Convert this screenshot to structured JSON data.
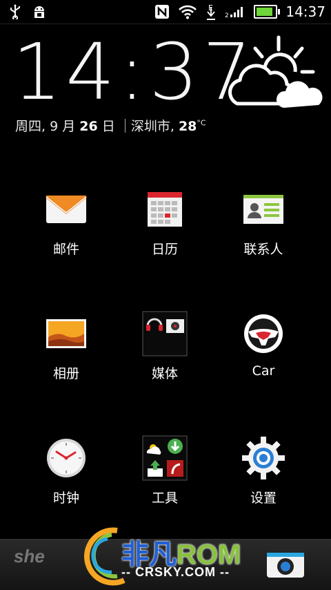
{
  "status_bar": {
    "time": "14:37",
    "icons": [
      "usb-icon",
      "android-debug-icon",
      "nfc-icon",
      "wifi-icon",
      "data-e-icon",
      "signal-icon",
      "battery-icon"
    ],
    "battery_level": 0.9,
    "battery_color": "#6fd63a"
  },
  "clock_widget": {
    "time": "14:37",
    "weekday": "周四,",
    "month": "9",
    "month_unit": "月",
    "day": "26",
    "day_unit": "日",
    "city": "深圳市,",
    "temperature": "28",
    "temp_unit": "°C",
    "weather_icon": "partly-cloudy-icon"
  },
  "apps": [
    {
      "label": "邮件",
      "icon": "mail-icon"
    },
    {
      "label": "日历",
      "icon": "calendar-icon"
    },
    {
      "label": "联系人",
      "icon": "contacts-icon"
    },
    {
      "label": "相册",
      "icon": "gallery-icon"
    },
    {
      "label": "媒体",
      "icon": "media-folder-icon"
    },
    {
      "label": "Car",
      "icon": "steering-wheel-icon"
    },
    {
      "label": "时钟",
      "icon": "clock-icon"
    },
    {
      "label": "工具",
      "icon": "tools-folder-icon"
    },
    {
      "label": "设置",
      "icon": "gear-icon"
    }
  ],
  "watermark": {
    "brand": "非凡",
    "rom": "ROM",
    "site": "-- CRSKY.COM --",
    "left_mark": "she"
  }
}
